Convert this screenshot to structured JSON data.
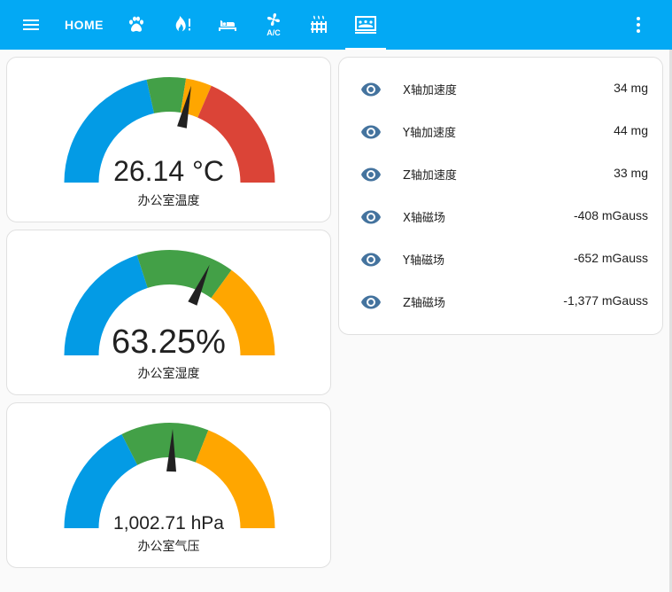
{
  "toolbar": {
    "menu_icon": "menu-icon",
    "home_label": "HOME",
    "tabs": [
      {
        "icon": "paw-icon"
      },
      {
        "icon": "fire-alert-icon"
      },
      {
        "icon": "bed-icon"
      },
      {
        "icon": "air-conditioner-icon"
      },
      {
        "icon": "radiator-icon"
      },
      {
        "icon": "sensor-dashboard-icon",
        "active": true
      }
    ],
    "more_icon": "dots-vertical-icon"
  },
  "colors": {
    "toolbar": "#03a9f4",
    "gauge_blue": "#039be5",
    "gauge_green": "#43a047",
    "gauge_orange": "#ffa600",
    "gauge_red": "#db4437",
    "eye_icon": "#44739e"
  },
  "gauges": [
    {
      "name": "办公室温度",
      "value_text": "26.14 °C",
      "value": 26.14,
      "min": 0,
      "max": 50,
      "needle_fraction": 0.57,
      "segments": [
        {
          "from": 0,
          "to": 0.43,
          "color": "#039be5"
        },
        {
          "from": 0.43,
          "to": 0.55,
          "color": "#43a047"
        },
        {
          "from": 0.55,
          "to": 0.63,
          "color": "#ffa600"
        },
        {
          "from": 0.63,
          "to": 1,
          "color": "#db4437"
        }
      ]
    },
    {
      "name": "办公室湿度",
      "value_text": "63.25%",
      "value": 63.25,
      "min": 0,
      "max": 100,
      "needle_fraction": 0.6325,
      "segments": [
        {
          "from": 0,
          "to": 0.4,
          "color": "#039be5"
        },
        {
          "from": 0.4,
          "to": 0.7,
          "color": "#43a047"
        },
        {
          "from": 0.7,
          "to": 1,
          "color": "#ffa600"
        }
      ]
    },
    {
      "name": "办公室气压",
      "value_text": "1,002.71 hPa",
      "value": 1002.71,
      "needle_fraction": 0.51,
      "segments": [
        {
          "from": 0,
          "to": 0.35,
          "color": "#039be5"
        },
        {
          "from": 0.35,
          "to": 0.62,
          "color": "#43a047"
        },
        {
          "from": 0.62,
          "to": 1,
          "color": "#ffa600"
        }
      ]
    }
  ],
  "entities": [
    {
      "icon": "eye-icon",
      "name": "X轴加速度",
      "value": "34 mg"
    },
    {
      "icon": "eye-icon",
      "name": "Y轴加速度",
      "value": "44 mg"
    },
    {
      "icon": "eye-icon",
      "name": "Z轴加速度",
      "value": "33 mg"
    },
    {
      "icon": "eye-icon",
      "name": "X轴磁场",
      "value": "-408 mGauss"
    },
    {
      "icon": "eye-icon",
      "name": "Y轴磁场",
      "value": "-652 mGauss"
    },
    {
      "icon": "eye-icon",
      "name": "Z轴磁场",
      "value": "-1,377 mGauss"
    }
  ]
}
